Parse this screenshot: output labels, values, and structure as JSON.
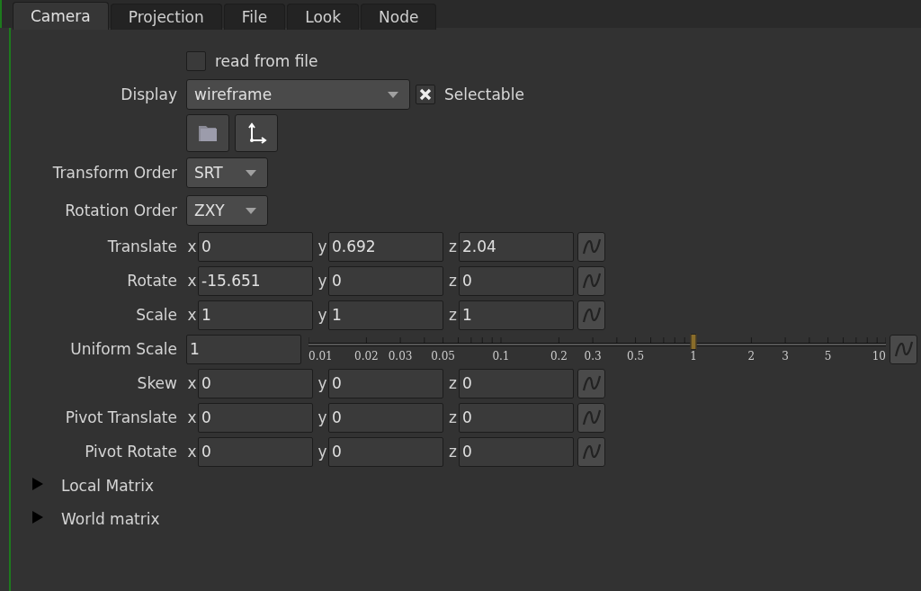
{
  "tabs": [
    {
      "label": "Camera",
      "selected": true
    },
    {
      "label": "Projection",
      "selected": false
    },
    {
      "label": "File",
      "selected": false
    },
    {
      "label": "Look",
      "selected": false
    },
    {
      "label": "Node",
      "selected": false
    }
  ],
  "read_from_file": {
    "label": "read from file",
    "checked": false
  },
  "display": {
    "label": "Display",
    "value": "wireframe"
  },
  "selectable": {
    "label": "Selectable",
    "checked": true
  },
  "transform_order": {
    "label": "Transform Order",
    "value": "SRT"
  },
  "rotation_order": {
    "label": "Rotation Order",
    "value": "ZXY"
  },
  "vectors_top": [
    {
      "label": "Translate",
      "fields": [
        {
          "axis": "x",
          "value": "0"
        },
        {
          "axis": "y",
          "value": "0.692"
        },
        {
          "axis": "z",
          "value": "2.04"
        }
      ]
    },
    {
      "label": "Rotate",
      "fields": [
        {
          "axis": "x",
          "value": "-15.651"
        },
        {
          "axis": "y",
          "value": "0"
        },
        {
          "axis": "z",
          "value": "0"
        }
      ]
    },
    {
      "label": "Scale",
      "fields": [
        {
          "axis": "x",
          "value": "1"
        },
        {
          "axis": "y",
          "value": "1"
        },
        {
          "axis": "z",
          "value": "1"
        }
      ]
    }
  ],
  "uniform_scale": {
    "label": "Uniform Scale",
    "value": "1",
    "level": 0.667,
    "tick_labels": [
      "0.01",
      "0.02",
      "0.03",
      "0.05",
      "0.1",
      "0.2",
      "0.3",
      "0.5",
      "1",
      "2",
      "3",
      "5",
      "10"
    ]
  },
  "vectors_bottom": [
    {
      "label": "Skew",
      "fields": [
        {
          "axis": "x",
          "value": "0"
        },
        {
          "axis": "y",
          "value": "0"
        },
        {
          "axis": "z",
          "value": "0"
        }
      ]
    },
    {
      "label": "Pivot Translate",
      "fields": [
        {
          "axis": "x",
          "value": "0"
        },
        {
          "axis": "y",
          "value": "0"
        },
        {
          "axis": "z",
          "value": "0"
        }
      ]
    },
    {
      "label": "Pivot Rotate",
      "fields": [
        {
          "axis": "x",
          "value": "0"
        },
        {
          "axis": "y",
          "value": "0"
        },
        {
          "axis": "z",
          "value": "0"
        }
      ]
    }
  ],
  "sections": [
    {
      "label": "Local Matrix",
      "expanded": false
    },
    {
      "label": "World matrix",
      "expanded": false
    }
  ]
}
